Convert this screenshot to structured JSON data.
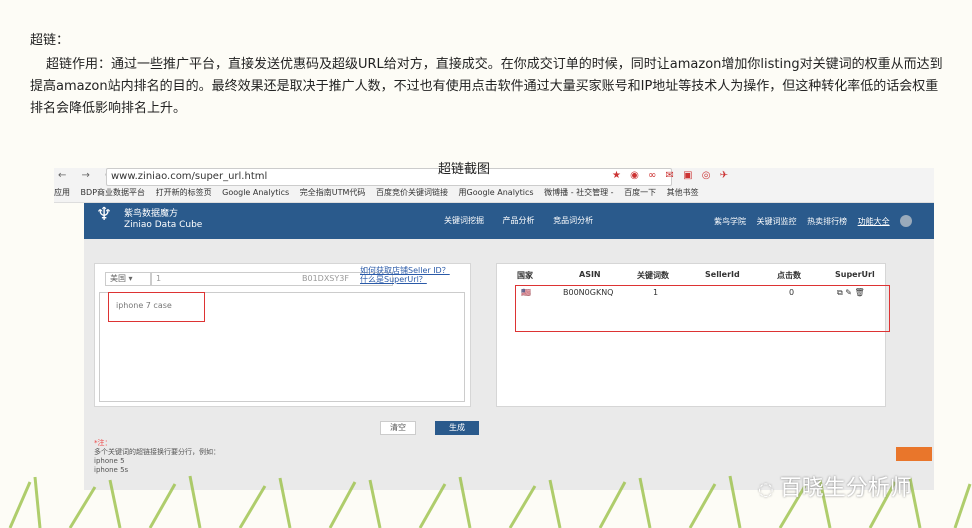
{
  "article": {
    "heading": "超链：",
    "paragraph": "超链作用：通过一些推广平台，直接发送优惠码及超级URL给对方，直接成交。在你成交订单的时候，同时让amazon增加你listing对关键词的权重从而达到提高amazon站内排名的目的。最终效果还是取决于推广人数，不过也有使用点击软件通过大量买家账号和IP地址等技术人为操作，但这种转化率低的话会权重排名会降低影响排名上升。"
  },
  "screenshot": {
    "caption": "超链截图",
    "browser": {
      "nav": "← → C",
      "url": "www.ziniao.com/super_url.html",
      "bookmarks": [
        "应用",
        "BDP商业数据平台",
        "打开新的标签页",
        "Google Analytics",
        "完全指南UTM代码",
        "百度竞价关键词链接",
        "用Google Analytics",
        "微博播 - 社交管理 -",
        "百度一下",
        "其他书签"
      ]
    },
    "app": {
      "logo_title": "紫鸟数据魔方",
      "logo_subtitle": "Ziniao Data Cube",
      "nav": [
        "关键词挖掘",
        "产品分析",
        "竞品词分析"
      ],
      "nav_right": [
        "紫鸟学院",
        "关键词监控",
        "热卖排行榜",
        "功能大全"
      ],
      "form": {
        "country": "美国 ▾",
        "keyword_prefix": "1",
        "asin_placeholder": "B01DXSY3F",
        "help_link1": "如何获取店铺Seller ID？",
        "help_link2": "什么是SuperUrl？",
        "textarea_value": "iphone 7 case"
      },
      "table": {
        "headers": [
          "国家",
          "ASIN",
          "关键词数",
          "SellerId",
          "点击数",
          "SuperUrl"
        ],
        "rows": [
          {
            "country": "🇺🇸",
            "asin": "B00N0GKNQ",
            "kw_count": "1",
            "seller": "",
            "clicks": "0",
            "actions": "⧉ ✎ 🗑"
          }
        ]
      },
      "buttons": {
        "clear": "清空",
        "generate": "生成"
      },
      "note": {
        "star": "*注：",
        "line1": "多个关键词的超链接换行要分行，例如：",
        "line2": "iphone 5",
        "line3": "iphone 5s"
      }
    }
  },
  "watermark": "百晓生分析师"
}
